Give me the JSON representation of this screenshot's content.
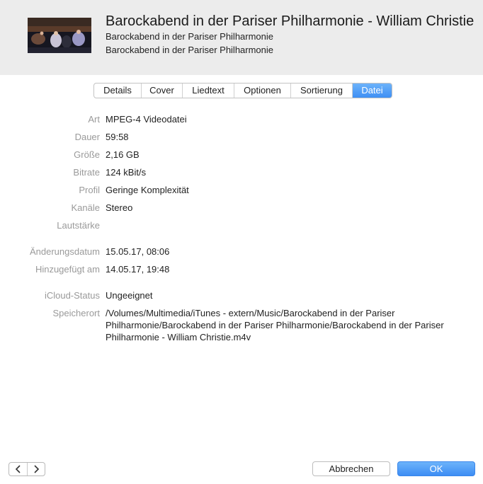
{
  "header": {
    "title": "Barockabend in der Pariser Philharmonie - William Christie",
    "subtitle1": "Barockabend in der Pariser Philharmonie",
    "subtitle2": "Barockabend in der Pariser Philharmonie"
  },
  "tabs": [
    "Details",
    "Cover",
    "Liedtext",
    "Optionen",
    "Sortierung",
    "Datei"
  ],
  "active_tab": "Datei",
  "info": {
    "art": {
      "label": "Art",
      "value": "MPEG-4 Videodatei"
    },
    "dauer": {
      "label": "Dauer",
      "value": "59:58"
    },
    "groesse": {
      "label": "Größe",
      "value": "2,16 GB"
    },
    "bitrate": {
      "label": "Bitrate",
      "value": "124 kBit/s"
    },
    "profil": {
      "label": "Profil",
      "value": "Geringe Komplexität"
    },
    "kanaele": {
      "label": "Kanäle",
      "value": "Stereo"
    },
    "lautstaerke": {
      "label": "Lautstärke",
      "value": ""
    },
    "aenderungsdatum": {
      "label": "Änderungsdatum",
      "value": "15.05.17, 08:06"
    },
    "hinzugefuegt": {
      "label": "Hinzugefügt am",
      "value": "14.05.17, 19:48"
    },
    "icloud": {
      "label": "iCloud-Status",
      "value": "Ungeeignet"
    },
    "speicherort": {
      "label": "Speicherort",
      "value": "/Volumes/Multimedia/iTunes - extern/Music/Barockabend in der Pariser\nPhilharmonie/Barockabend in der Pariser Philharmonie/Barockabend in der Pariser\nPhilharmonie - William Christie.m4v"
    }
  },
  "buttons": {
    "cancel": "Abbrechen",
    "ok": "OK"
  },
  "icons": {
    "prev": "chevron-left-icon",
    "next": "chevron-right-icon"
  },
  "colors": {
    "accent": "#3f8ff4",
    "header_bg": "#ececec",
    "label": "#9a9a9a"
  }
}
